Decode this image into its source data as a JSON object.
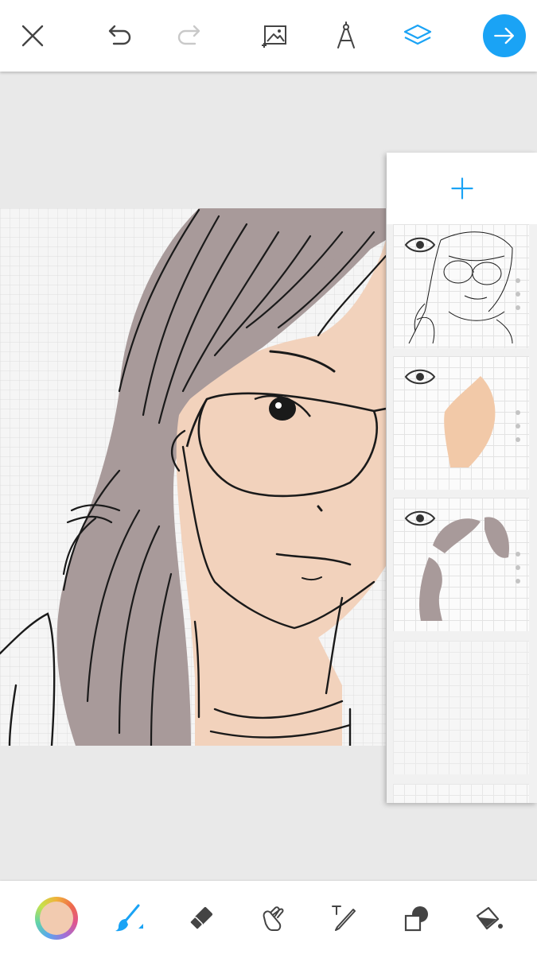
{
  "topbar": {
    "icons": [
      "close-icon",
      "undo-icon",
      "redo-icon",
      "add-image-icon",
      "ruler-compass-icon",
      "layers-icon",
      "next-arrow-icon"
    ],
    "accent_color": "#1aa3f5"
  },
  "canvas": {
    "skin_color": "#f2d2bc",
    "hair_color": "#a89a9a",
    "line_color": "#1a1a1a"
  },
  "layers_panel": {
    "add_icon": "plus-icon",
    "layers": [
      {
        "name": "line-art",
        "visible": true
      },
      {
        "name": "skin-color",
        "visible": true
      },
      {
        "name": "hair-color",
        "visible": true
      },
      {
        "name": "blank",
        "visible": false
      }
    ]
  },
  "bottombar": {
    "current_color": "#f2cbb0",
    "tools": [
      "color-picker",
      "brush-icon",
      "eraser-icon",
      "smudge-icon",
      "text-icon",
      "shape-icon",
      "fill-bucket-icon"
    ],
    "active_tool": "brush-icon"
  }
}
